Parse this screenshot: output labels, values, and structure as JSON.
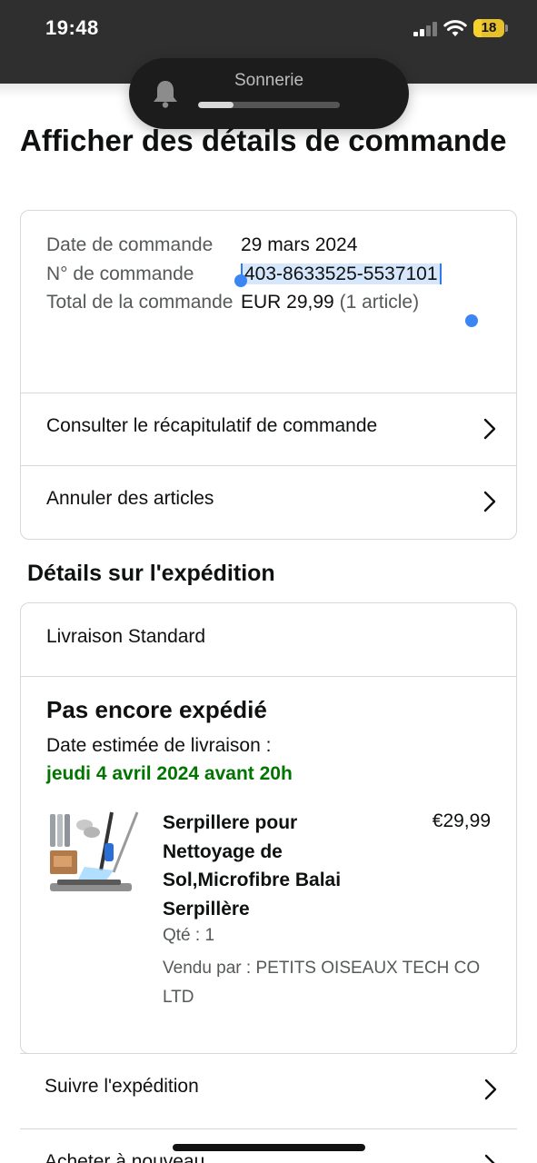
{
  "status_bar": {
    "time": "19:48",
    "battery": "18",
    "battery_color": "#e6c12a"
  },
  "ringer": {
    "label": "Sonnerie",
    "level": 0.25
  },
  "page": {
    "title": "Afficher des détails de commande"
  },
  "order_summary": {
    "date_label": "Date de commande",
    "date_value": "29 mars 2024",
    "number_label": "N° de commande",
    "number_value": "403-8633525-5537101",
    "total_label": "Total de la commande",
    "total_value": "EUR 29,99",
    "total_items": "(1 article)",
    "actions": {
      "summary": "Consulter le récapitulatif de commande",
      "cancel": "Annuler des articles"
    }
  },
  "shipping": {
    "section_title": "Détails sur l'expédition",
    "method": "Livraison Standard",
    "status": "Pas encore expédié",
    "estimate_label": "Date estimée de livraison :",
    "estimate_date": "jeudi 4 avril 2024 avant 20h",
    "estimate_color": "#007600",
    "item": {
      "name": "Serpillere pour Nettoyage de Sol,Microfibre Balai Serpillère",
      "price": "€29,99",
      "qty": "Qté : 1",
      "seller": "Vendu par : PETITS OISEAUX TECH CO LTD"
    },
    "actions": {
      "track": "Suivre l'expédition",
      "buy_again": "Acheter à nouveau"
    }
  }
}
